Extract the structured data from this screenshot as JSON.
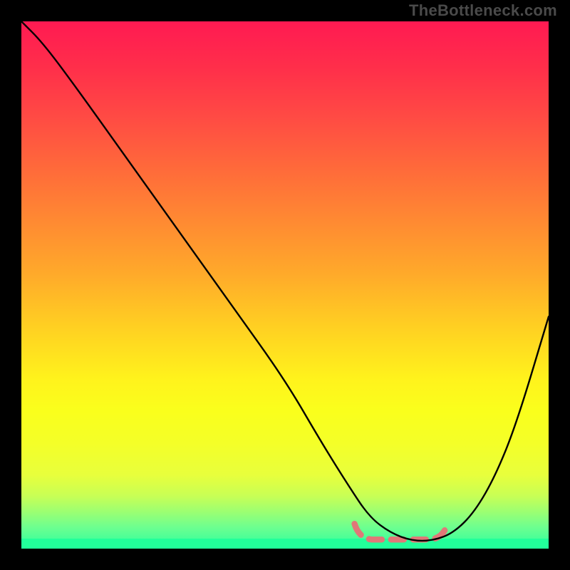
{
  "watermark": "TheBottleneck.com",
  "chart_data": {
    "type": "line",
    "title": "",
    "xlabel": "",
    "ylabel": "",
    "xlim": [
      0,
      100
    ],
    "ylim": [
      0,
      100
    ],
    "gradient_axis": "y",
    "gradient_meaning": "bottleneck-severity: top=high (red), bottom=optimal (green)",
    "gradient_stops": [
      {
        "pct": 0,
        "color": "#ff1a52"
      },
      {
        "pct": 9,
        "color": "#ff2f4a"
      },
      {
        "pct": 18,
        "color": "#ff4a44"
      },
      {
        "pct": 28,
        "color": "#ff6a3a"
      },
      {
        "pct": 38,
        "color": "#ff8a32"
      },
      {
        "pct": 48,
        "color": "#ffaa2a"
      },
      {
        "pct": 58,
        "color": "#ffd022"
      },
      {
        "pct": 68,
        "color": "#fff31c"
      },
      {
        "pct": 74,
        "color": "#faff1c"
      },
      {
        "pct": 80,
        "color": "#f4ff28"
      },
      {
        "pct": 86,
        "color": "#e8ff3c"
      },
      {
        "pct": 90,
        "color": "#c8ff55"
      },
      {
        "pct": 93,
        "color": "#9cff72"
      },
      {
        "pct": 96,
        "color": "#6cff90"
      },
      {
        "pct": 100,
        "color": "#28ff9e"
      }
    ],
    "series": [
      {
        "name": "bottleneck-curve",
        "x": [
          0,
          4,
          10,
          20,
          30,
          40,
          50,
          57,
          62,
          66,
          70,
          74,
          78,
          82,
          86,
          90,
          94,
          100
        ],
        "y": [
          100,
          96,
          88,
          74,
          60,
          46,
          32,
          20,
          12,
          6,
          3,
          1.5,
          1.5,
          3,
          7,
          14,
          24,
          44
        ]
      }
    ],
    "optimal_region": {
      "x_start": 64,
      "x_end": 80,
      "y": 2
    }
  }
}
